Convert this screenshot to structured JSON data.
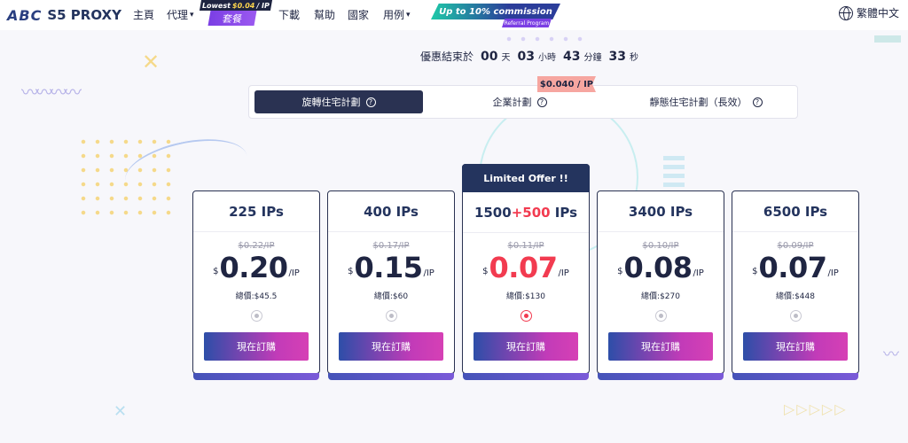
{
  "nav": {
    "logo_abc": "ABC",
    "logo_text": "S5 PROXY",
    "items": [
      {
        "label": "主頁",
        "dropdown": false
      },
      {
        "label": "代理",
        "dropdown": true
      },
      {
        "label": "下載",
        "dropdown": false
      },
      {
        "label": "幫助",
        "dropdown": false
      },
      {
        "label": "國家",
        "dropdown": false
      },
      {
        "label": "用例",
        "dropdown": true
      }
    ],
    "promo_package": {
      "line1_prefix": "Lowest",
      "line1_price": "$0.04",
      "line1_suffix": "/ IP",
      "label": "套餐"
    },
    "commission": {
      "title": "Up to 10% commission",
      "subtitle": "Referral Program"
    },
    "language": "繁體中文"
  },
  "countdown": {
    "prefix": "優惠結束於",
    "days": "00",
    "days_unit": "天",
    "hours": "03",
    "hours_unit": "小時",
    "minutes": "43",
    "minutes_unit": "分鐘",
    "seconds": "33",
    "seconds_unit": "秒"
  },
  "tabs": [
    {
      "label": "旋轉住宅計劃",
      "active": true
    },
    {
      "label": "企業計劃",
      "active": false
    },
    {
      "label": "靜態住宅計劃（長效）",
      "active": false
    }
  ],
  "tab_price_flag": "$0.040 / IP",
  "featured_badge": "Limited Offer !!",
  "plans": [
    {
      "title": "225 IPs",
      "orig": "$0.22/IP",
      "currency": "$",
      "price": "0.20",
      "per": "/IP",
      "total": "總價:$45.5",
      "selected": false,
      "red": false
    },
    {
      "title": "400 IPs",
      "orig": "$0.17/IP",
      "currency": "$",
      "price": "0.15",
      "per": "/IP",
      "total": "總價:$60",
      "selected": false,
      "red": false
    },
    {
      "title_base": "1500",
      "title_plus": "+500",
      "title_unit": " IPs",
      "orig": "$0.11/IP",
      "currency": "$",
      "price": "0.07",
      "per": "/IP",
      "total": "總價:$130",
      "selected": true,
      "red": true
    },
    {
      "title": "3400 IPs",
      "orig": "$0.10/IP",
      "currency": "$",
      "price": "0.08",
      "per": "/IP",
      "total": "總價:$270",
      "selected": false,
      "red": false
    },
    {
      "title": "6500 IPs",
      "orig": "$0.09/IP",
      "currency": "$",
      "price": "0.07",
      "per": "/IP",
      "total": "總價:$448",
      "selected": false,
      "red": false
    }
  ],
  "buy_label": "現在訂購",
  "colors": {
    "navy": "#24345e",
    "accent_red": "#f23b50",
    "button_gradient_start": "#2d4ea8",
    "button_gradient_end": "#d640b5"
  }
}
